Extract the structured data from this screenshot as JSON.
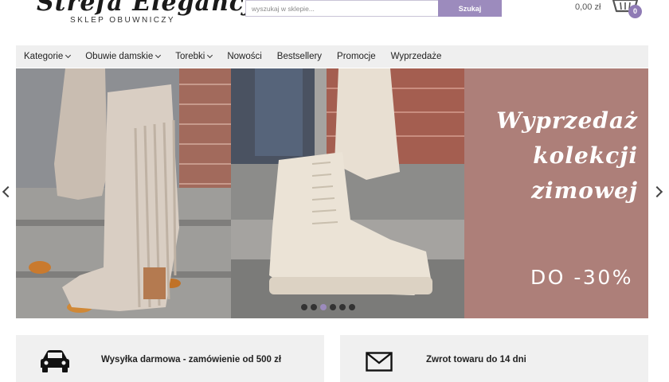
{
  "header": {
    "logo_script": "Strefa Elegancji",
    "logo_subtitle": "SKLEP OBUWNICZY",
    "search_placeholder": "wyszukaj w sklepie...",
    "search_button": "Szukaj",
    "cart_total": "0,00 zł",
    "cart_count": "0"
  },
  "nav": {
    "items": [
      {
        "label": "Kategorie",
        "dropdown": true
      },
      {
        "label": "Obuwie damskie",
        "dropdown": true
      },
      {
        "label": "Torebki",
        "dropdown": true
      },
      {
        "label": "Nowości",
        "dropdown": false
      },
      {
        "label": "Bestsellery",
        "dropdown": false
      },
      {
        "label": "Promocje",
        "dropdown": false
      },
      {
        "label": "Wyprzedaże",
        "dropdown": false
      }
    ]
  },
  "slider": {
    "promo_title": "Wyprzedaż\nkolekcji\nzimowej",
    "promo_discount": "DO -30%",
    "slide_count": 6,
    "active_slide": 3
  },
  "features": [
    {
      "icon": "car-icon",
      "text": "Wysyłka darmowa - zamówienie od 500 zł"
    },
    {
      "icon": "envelope-icon",
      "text": "Zwrot towaru do 14 dni"
    }
  ],
  "colors": {
    "accent": "#9c8bbd",
    "badge": "#8f7bb5",
    "promo_bg": "#ad7f79",
    "nav_bg": "#efefef",
    "feature_bg": "#f0f0f0"
  }
}
